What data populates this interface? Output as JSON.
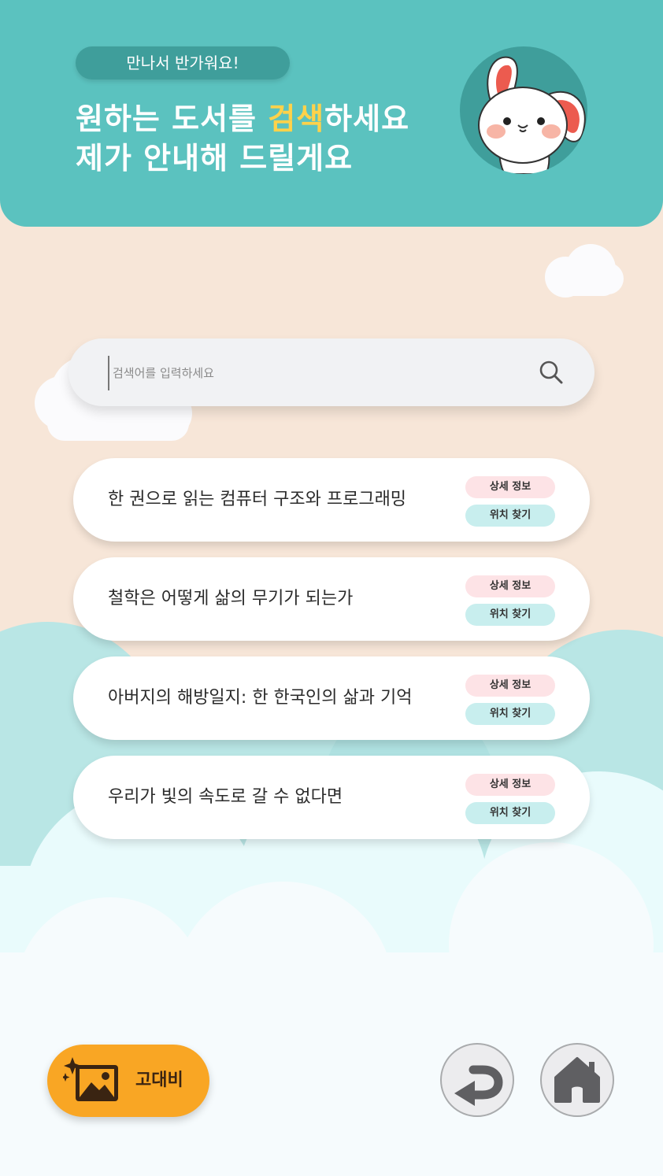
{
  "header": {
    "greeting": "만나서 반가워요!",
    "headline_pre": "원하는 도서를 ",
    "headline_highlight": "검색",
    "headline_post": "하세요",
    "headline_line2": "제가 안내해 드릴게요"
  },
  "search": {
    "placeholder": "검색어를 입력하세요",
    "value": ""
  },
  "results": [
    {
      "title": "한 권으로 읽는 컴퓨터 구조와 프로그래밍",
      "detail_label": "상세 정보",
      "locate_label": "위치 찾기"
    },
    {
      "title": "철학은 어떻게 삶의 무기가 되는가",
      "detail_label": "상세 정보",
      "locate_label": "위치 찾기"
    },
    {
      "title": "아버지의 해방일지: 한 한국인의 삶과 기억",
      "detail_label": "상세 정보",
      "locate_label": "위치 찾기"
    },
    {
      "title": "우리가 빛의 속도로 갈 수 없다면",
      "detail_label": "상세 정보",
      "locate_label": "위치 찾기"
    }
  ],
  "bottom": {
    "gdb_label": "고대비",
    "gdb_icon": "sparkle-image-icon",
    "back_icon": "back-arrow-icon",
    "home_icon": "home-icon"
  },
  "colors": {
    "header": "#5bc2bf",
    "accent_text": "#ffd24a",
    "background": "#f7e6d8",
    "gdb_button": "#f9a624"
  }
}
